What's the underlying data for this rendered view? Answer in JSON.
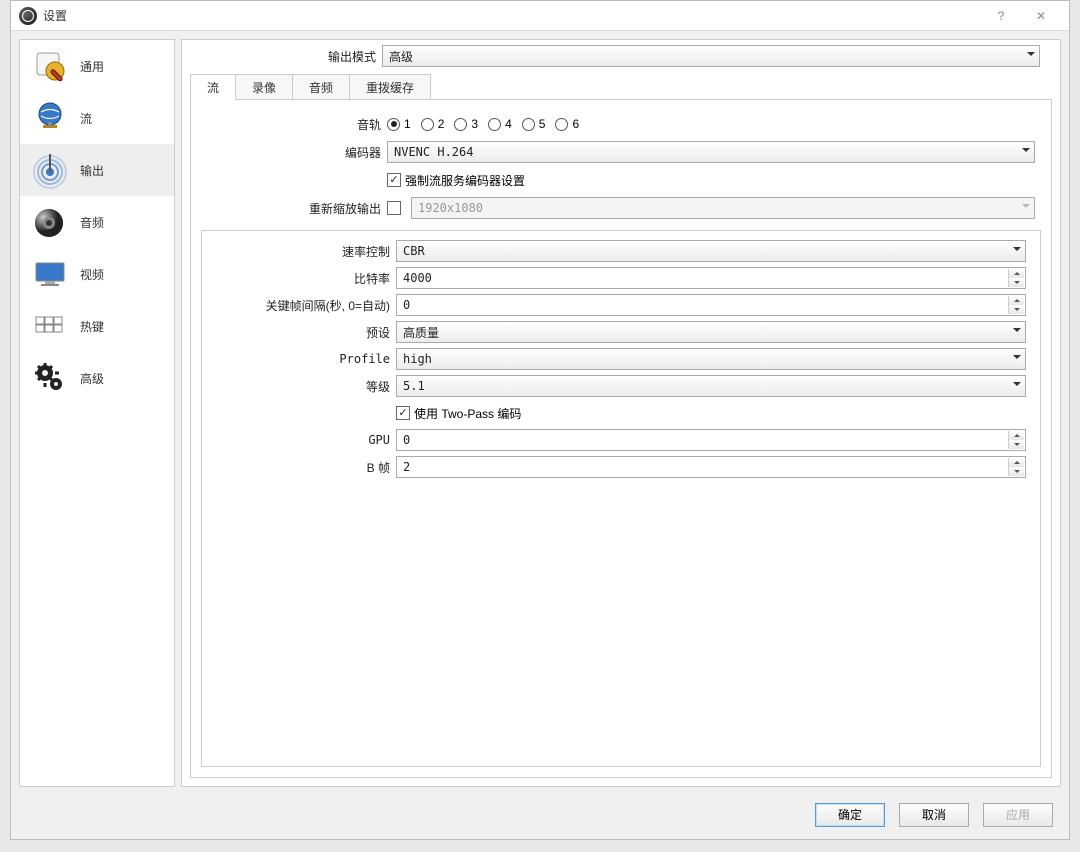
{
  "window": {
    "title": "设置"
  },
  "sidebar": {
    "items": [
      {
        "label": "通用",
        "icon": "general"
      },
      {
        "label": "流",
        "icon": "stream"
      },
      {
        "label": "输出",
        "icon": "output"
      },
      {
        "label": "音频",
        "icon": "audio"
      },
      {
        "label": "视频",
        "icon": "video"
      },
      {
        "label": "热键",
        "icon": "hotkeys"
      },
      {
        "label": "高级",
        "icon": "advanced"
      }
    ],
    "active_index": 2
  },
  "mode": {
    "label": "输出模式",
    "value": "高级"
  },
  "tabs": {
    "items": [
      "流",
      "录像",
      "音频",
      "重拨缓存"
    ],
    "active_index": 0
  },
  "stream": {
    "audio_track": {
      "label": "音轨",
      "options": [
        "1",
        "2",
        "3",
        "4",
        "5",
        "6"
      ],
      "selected": "1"
    },
    "encoder": {
      "label": "编码器",
      "value": "NVENC H.264"
    },
    "enforce_chk": {
      "label": "强制流服务编码器设置",
      "checked": true
    },
    "rescale": {
      "label": "重新缩放输出",
      "checked": false,
      "value": "1920x1080"
    },
    "rate_control": {
      "label": "速率控制",
      "value": "CBR"
    },
    "bitrate": {
      "label": "比特率",
      "value": "4000"
    },
    "keyint": {
      "label": "关键帧间隔(秒, 0=自动)",
      "value": "0"
    },
    "preset": {
      "label": "预设",
      "value": "高质量"
    },
    "profile": {
      "label": "Profile",
      "value": "high"
    },
    "level": {
      "label": "等级",
      "value": "5.1"
    },
    "two_pass": {
      "label": "使用 Two-Pass 编码",
      "checked": true
    },
    "gpu": {
      "label": "GPU",
      "value": "0"
    },
    "bframes": {
      "label": "B 帧",
      "value": "2"
    }
  },
  "footer": {
    "ok": "确定",
    "cancel": "取消",
    "apply": "应用"
  }
}
